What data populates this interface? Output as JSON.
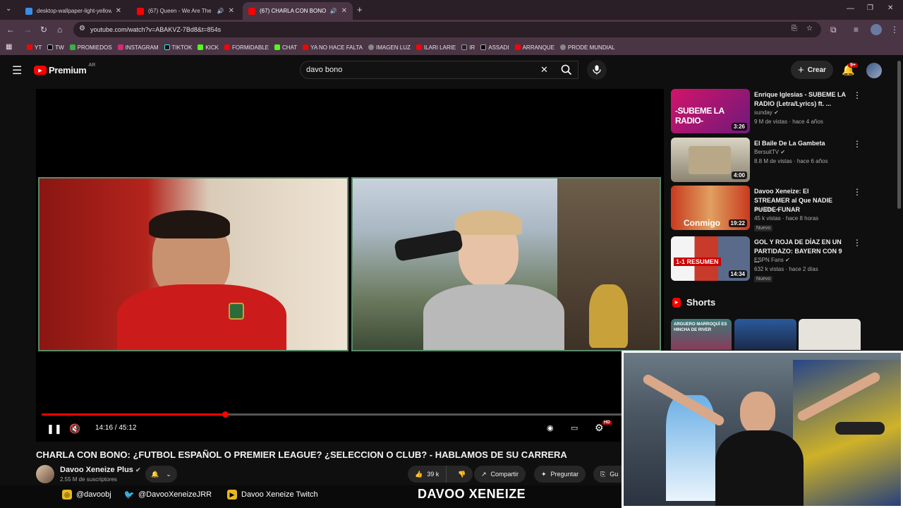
{
  "browser": {
    "tabs": [
      {
        "title": "desktop-wallpaper-light-yellow..."
      },
      {
        "title": "(67) Queen - We Are The C..."
      },
      {
        "title": "(67) CHARLA CON BONO: ..."
      }
    ],
    "url": "youtube.com/watch?v=ABAKVZ-7Bd8&t=854s",
    "bookmarks": [
      "YT",
      "TW",
      "PROMIEDOS",
      "INSTAGRAM",
      "TIKTOK",
      "KICK",
      "FORMIDABLE",
      "CHAT",
      "YA NO HACE FALTA",
      "IMAGEN LUZ",
      "ILARI LARIE",
      "IR",
      "ASSADI",
      "ARRANQUE",
      "PRODE MUNDIAL"
    ]
  },
  "youtube": {
    "logo": "Premium",
    "region": "AR",
    "search_value": "davo bono",
    "create_label": "Crear",
    "notif_count": "9+"
  },
  "player": {
    "time": "14:16 / 45:12",
    "progress": 0.316,
    "hd_badge": "HD"
  },
  "video": {
    "title": "CHARLA CON BONO: ¿FUTBOL ESPAÑOL O PREMIER LEAGUE? ¿SELECCION O CLUB? - HABLAMOS DE SU CARRERA",
    "channel": "Davoo Xeneize Plus",
    "subscribers": "2.55 M de suscriptores",
    "likes": "39 k",
    "share_label": "Compartir",
    "ask_label": "Preguntar",
    "save_label": "Gu"
  },
  "suggestions": [
    {
      "title": "Enrique Iglesias - SUBEME LA RADIO (Letra/Lyrics) ft. ...",
      "channel": "sunday",
      "stats": "9 M de vistas · hace 4 años",
      "duration": "3:26",
      "thumb_text": "-SUBEME LA RADIO-",
      "new": ""
    },
    {
      "title": "El Baile De La Gambeta",
      "channel": "BersuitTV",
      "stats": "8.8 M de vistas · hace 6 años",
      "duration": "4:00",
      "thumb_text": "",
      "new": ""
    },
    {
      "title": "Davoo Xeneize: El STREAMER al Que NADIE PUEDE FUNAR",
      "channel": "axeldea",
      "stats": "45 k vistas · hace 8 horas",
      "duration": "19:22",
      "thumb_text": "Conmigo",
      "new": "Nuevo"
    },
    {
      "title": "GOL Y ROJA DE DÍAZ EN UN PARTIDAZO: BAYERN CON 9 ...",
      "channel": "ESPN Fans",
      "stats": "632 k vistas · hace 2 días",
      "duration": "14:34",
      "thumb_text": "1-1 RESUMEN",
      "new": "Nuevo"
    }
  ],
  "shorts_label": "Shorts",
  "shorts_thumb_text": "ARGUERO MARROQUÍ ES HINCHA DE RIVER",
  "overlay": {
    "instagram": "@davoobj",
    "twitter": "@DavooXeneizeJRR",
    "twitch": "Davoo Xeneize Twitch",
    "brand": "DAVOO XENEIZE"
  },
  "colors": {
    "accent_red": "#ff0000",
    "browser_dark": "#2a1e27",
    "browser_mid": "#4a3545"
  }
}
